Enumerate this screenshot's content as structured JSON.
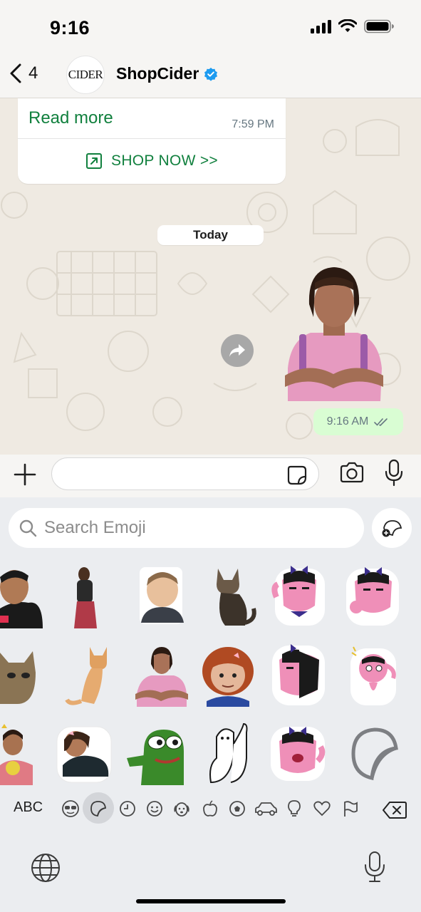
{
  "status_bar": {
    "time": "9:16"
  },
  "header": {
    "back_count": "4",
    "avatar_text": "CIDER",
    "contact_name": "ShopCider",
    "verified_color": "#1d9bf0"
  },
  "chat": {
    "card": {
      "read_more": "Read more",
      "time": "7:59 PM",
      "cta": "SHOP NOW >>"
    },
    "date_label": "Today",
    "sent": {
      "time": "9:16 AM",
      "status_icon": "double-check-icon"
    }
  },
  "input": {
    "placeholder": "",
    "value": ""
  },
  "emoji_panel": {
    "search_placeholder": "Search Emoji",
    "stickers": [
      "person-hoodie-sticker",
      "woman-standing-sticker",
      "smiling-boy-sticker",
      "cat-sitting-sticker",
      "pink-dog-waving-sticker",
      "pink-dog-thumbs-sticker",
      "cat-face-sticker",
      "orange-kitten-sticker",
      "wig-man-pink-shirt-sticker",
      "chucky-doll-sticker",
      "pink-dog-split-sticker",
      "pink-dog-surprised-sticker",
      "girl-with-toy-sticker",
      "person-lying-sticker",
      "pepe-frog-sticker",
      "line-cartoon-sticker",
      "pink-dog-cheer-sticker",
      "add-sticker-placeholder"
    ],
    "categories": [
      "frequent-icon",
      "sticker-icon",
      "clock-icon",
      "smiley-icon",
      "dog-icon",
      "apple-icon",
      "ball-icon",
      "car-icon",
      "bulb-icon",
      "heart-icon",
      "flag-icon"
    ],
    "abc_label": "ABC"
  },
  "colors": {
    "accent_green": "#11803e",
    "sent_bubble": "#d9fdd3",
    "chat_bg": "#efeae2"
  }
}
